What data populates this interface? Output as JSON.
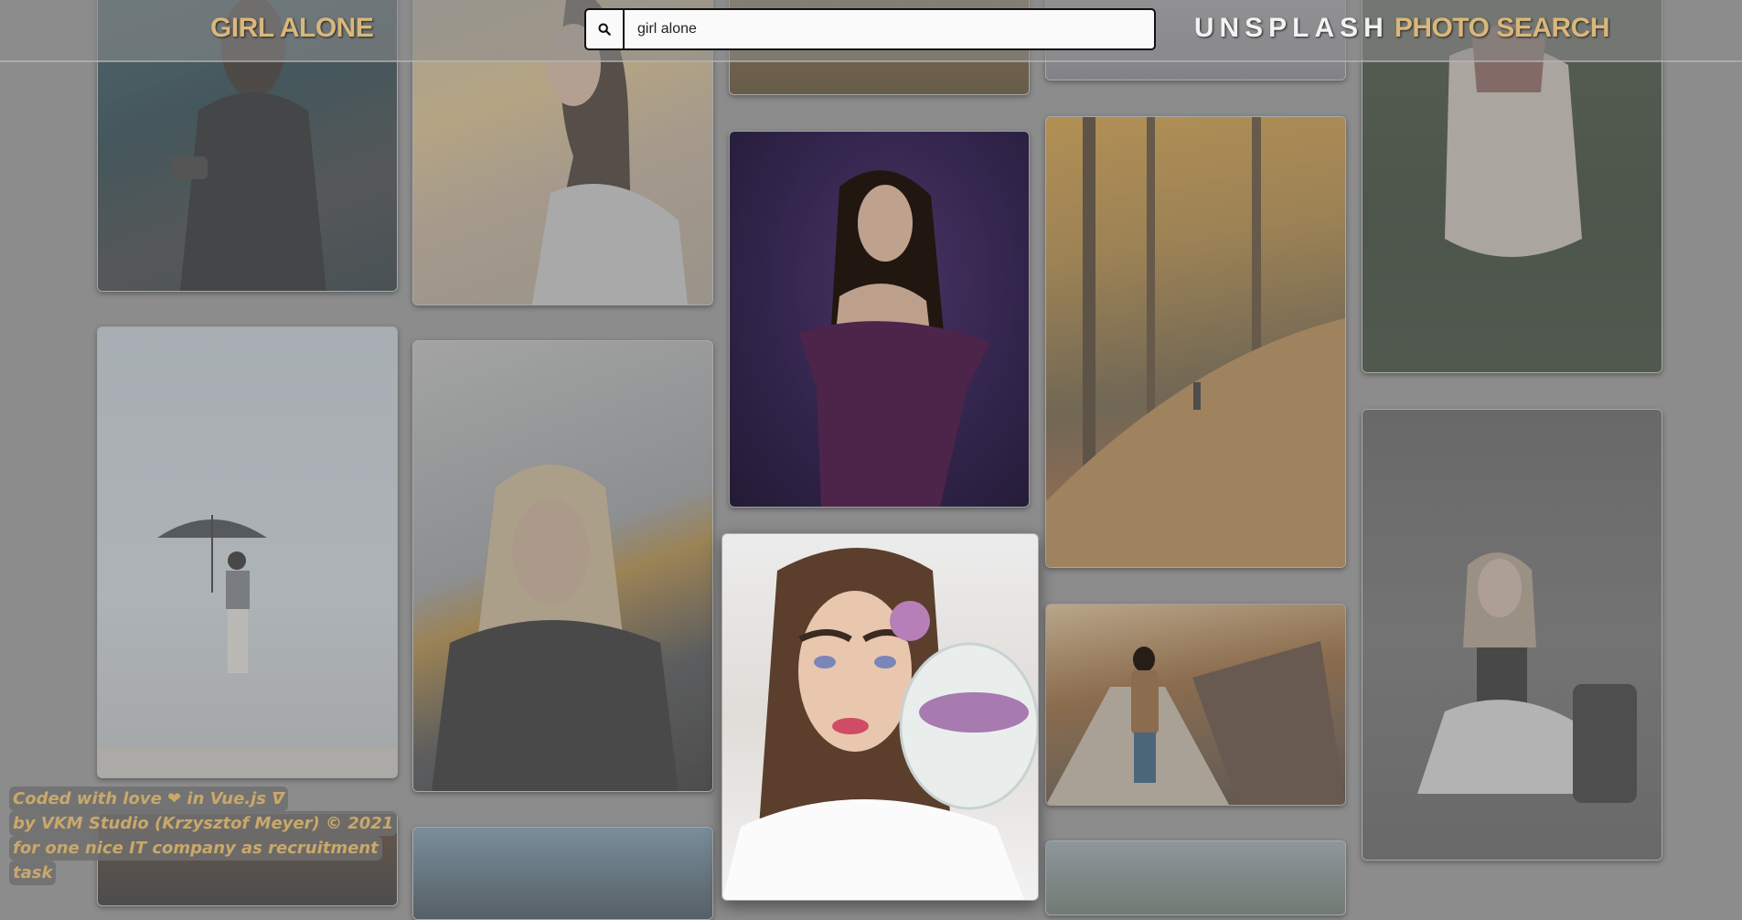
{
  "header": {
    "query_title": "GIRL ALONE",
    "brand_main": "UNSPLASH",
    "brand_sub": "PHOTO SEARCH"
  },
  "search": {
    "value": "girl alone",
    "icon": "search-icon"
  },
  "credits": {
    "line1": "Coded with love ❤ in Vue.js ᐁ",
    "line2": "by  VKM Studio (Krzysztof Meyer)  © 2021",
    "line3": "for one nice IT company as recruitment",
    "line4": "task"
  },
  "colors": {
    "accent": "#d9b77a",
    "background": "#8c8c8c"
  }
}
